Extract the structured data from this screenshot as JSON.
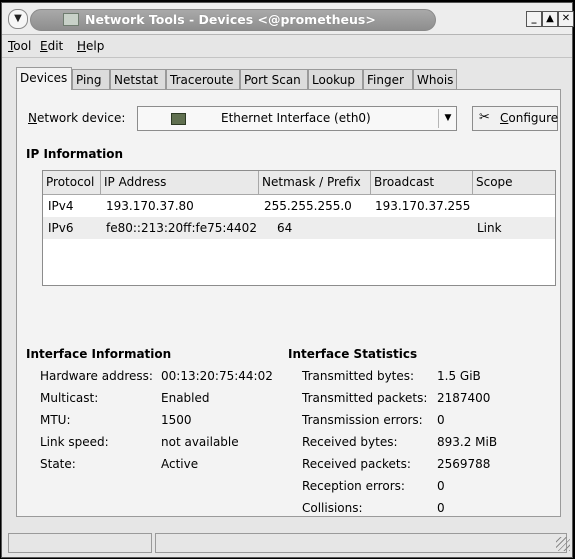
{
  "window": {
    "title": "Network Tools - Devices <@prometheus>"
  },
  "menu": [
    "Tool",
    "Edit",
    "Help"
  ],
  "tabs": [
    "Devices",
    "Ping",
    "Netstat",
    "Traceroute",
    "Port Scan",
    "Lookup",
    "Finger",
    "Whois"
  ],
  "device": {
    "label": "Network device:",
    "selected": "Ethernet Interface (eth0)",
    "configure_label": "Configure"
  },
  "ip_info": {
    "heading": "IP Information",
    "columns": [
      "Protocol",
      "IP Address",
      "Netmask / Prefix",
      "Broadcast",
      "Scope"
    ],
    "rows": [
      [
        "IPv4",
        "193.170.37.80",
        "255.255.255.0",
        "193.170.37.255",
        ""
      ],
      [
        "IPv6",
        "fe80::213:20ff:fe75:4402",
        "64",
        "",
        "Link"
      ]
    ]
  },
  "interface_info": {
    "heading": "Interface Information",
    "items": [
      {
        "label": "Hardware address:",
        "value": "00:13:20:75:44:02"
      },
      {
        "label": "Multicast:",
        "value": "Enabled"
      },
      {
        "label": "MTU:",
        "value": "1500"
      },
      {
        "label": "Link speed:",
        "value": "not available"
      },
      {
        "label": "State:",
        "value": "Active"
      }
    ]
  },
  "interface_stats": {
    "heading": "Interface Statistics",
    "items": [
      {
        "label": "Transmitted bytes:",
        "value": "1.5 GiB"
      },
      {
        "label": "Transmitted packets:",
        "value": "2187400"
      },
      {
        "label": "Transmission errors:",
        "value": "0"
      },
      {
        "label": "Received bytes:",
        "value": "893.2 MiB"
      },
      {
        "label": "Received packets:",
        "value": "2569788"
      },
      {
        "label": "Reception errors:",
        "value": "0"
      },
      {
        "label": "Collisions:",
        "value": "0"
      }
    ]
  },
  "colors": {
    "title_pill": "#999999",
    "panel": "#f3f3f3",
    "table_bg": "#ffffff"
  },
  "icons": {
    "window_menu": "chevron-down-icon",
    "title_app": "network-icon",
    "device": "ethernet-card-icon",
    "configure": "tools-icon",
    "combo": "chevron-down-icon",
    "minimize": "minimize-icon",
    "maximize": "maximize-icon",
    "close": "close-icon",
    "resize": "resize-grip-icon"
  }
}
